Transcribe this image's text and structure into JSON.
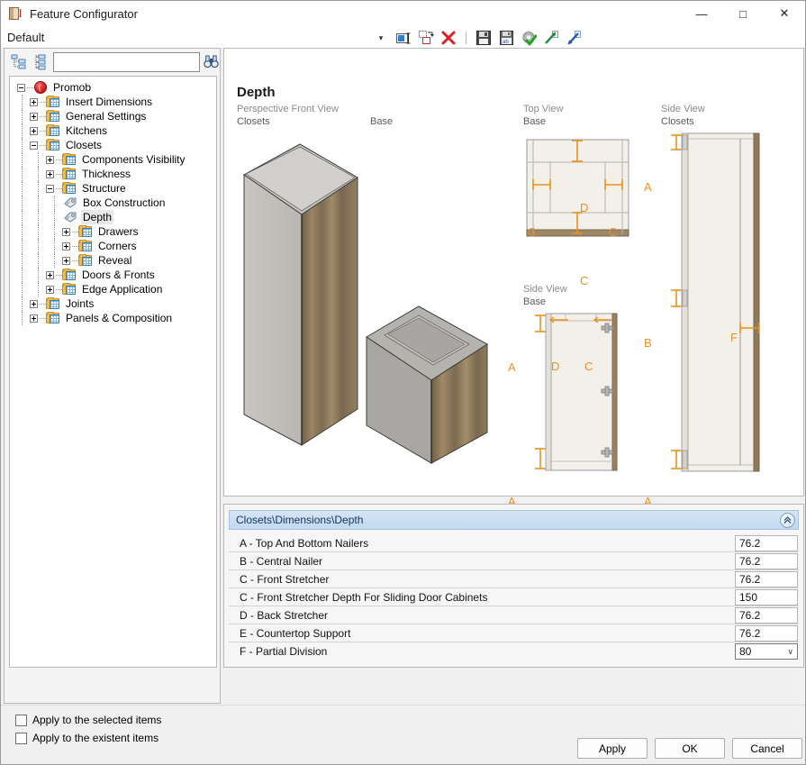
{
  "window": {
    "title": "Feature Configurator",
    "icon": "feature-configurator-icon",
    "minimize": "—",
    "maximize": "□",
    "close": "✕"
  },
  "toolbar": {
    "profile_label": "Default",
    "dropdown_arrow": "▾",
    "buttons": [
      {
        "name": "rename-button",
        "glyph": "rename-icon"
      },
      {
        "name": "duplicate-button",
        "glyph": "copy-icon"
      },
      {
        "name": "delete-button",
        "glyph": "delete-icon"
      },
      {
        "name": "save-button",
        "glyph": "save-icon"
      },
      {
        "name": "save-as-button",
        "glyph": "save-as-icon"
      },
      {
        "name": "apply-settings-button",
        "glyph": "gear-check-icon"
      },
      {
        "name": "export-button",
        "glyph": "export-arrow-icon"
      },
      {
        "name": "import-button",
        "glyph": "import-arrow-icon"
      }
    ]
  },
  "tree_panel": {
    "collapse_all_icon": "collapse-tree-icon",
    "expand_all_icon": "expand-tree-icon",
    "search": {
      "value": "",
      "placeholder": ""
    },
    "search_icon": "binoculars-icon",
    "nodes": [
      {
        "label": "Promob",
        "level": 0,
        "state": "expanded",
        "icon": "globe",
        "selected": false
      },
      {
        "label": "Insert Dimensions",
        "level": 1,
        "state": "collapsed",
        "icon": "folder",
        "selected": false
      },
      {
        "label": "General Settings",
        "level": 1,
        "state": "collapsed",
        "icon": "folder",
        "selected": false
      },
      {
        "label": "Kitchens",
        "level": 1,
        "state": "collapsed",
        "icon": "folder",
        "selected": false
      },
      {
        "label": "Closets",
        "level": 1,
        "state": "expanded",
        "icon": "folder",
        "selected": false
      },
      {
        "label": "Components Visibility",
        "level": 2,
        "state": "collapsed",
        "icon": "folder",
        "selected": false
      },
      {
        "label": "Thickness",
        "level": 2,
        "state": "collapsed",
        "icon": "folder",
        "selected": false
      },
      {
        "label": "Structure",
        "level": 2,
        "state": "expanded",
        "icon": "folder",
        "selected": false
      },
      {
        "label": "Box Construction",
        "level": 3,
        "state": "leaf",
        "icon": "tag",
        "selected": false
      },
      {
        "label": "Depth",
        "level": 3,
        "state": "leaf",
        "icon": "tag",
        "selected": true
      },
      {
        "label": "Drawers",
        "level": 3,
        "state": "collapsed",
        "icon": "folder",
        "selected": false
      },
      {
        "label": "Corners",
        "level": 3,
        "state": "collapsed",
        "icon": "folder",
        "selected": false
      },
      {
        "label": "Reveal",
        "level": 3,
        "state": "collapsed",
        "icon": "folder",
        "selected": false
      },
      {
        "label": "Doors & Fronts",
        "level": 2,
        "state": "collapsed",
        "icon": "folder",
        "selected": false
      },
      {
        "label": "Edge Application",
        "level": 2,
        "state": "collapsed",
        "icon": "folder",
        "selected": false
      },
      {
        "label": "Joints",
        "level": 1,
        "state": "collapsed",
        "icon": "folder",
        "selected": false
      },
      {
        "label": "Panels & Composition",
        "level": 1,
        "state": "collapsed",
        "icon": "folder",
        "selected": false
      }
    ]
  },
  "options": [
    {
      "label": "Apply to the selected items",
      "checked": false
    },
    {
      "label": "Apply to the existent items",
      "checked": false
    }
  ],
  "drawing": {
    "title": "Depth",
    "views": [
      {
        "kind": "Perspective Front View",
        "subject": "Closets"
      },
      {
        "kind": "",
        "subject": "Base"
      },
      {
        "kind": "Top View",
        "subject": "Base"
      },
      {
        "kind": "Side View",
        "subject": "Closets"
      },
      {
        "kind": "Side View",
        "subject": "Base"
      }
    ],
    "callout_color": "#e8921e",
    "callouts": {
      "top_view_base": [
        "D",
        "C",
        "C",
        "C"
      ],
      "side_view_base": [
        "A",
        "D",
        "C",
        "A"
      ],
      "side_view_closets": [
        "A",
        "B",
        "F",
        "A"
      ]
    }
  },
  "properties": {
    "header": "Closets\\Dimensions\\Depth",
    "collapse_glyph": "«",
    "rows": [
      {
        "name": "A - Top And Bottom Nailers",
        "value": "76.2",
        "type": "text"
      },
      {
        "name": "B - Central Nailer",
        "value": "76.2",
        "type": "text"
      },
      {
        "name": "C -  Front Stretcher",
        "value": "76.2",
        "type": "text"
      },
      {
        "name": "C - Front Stretcher Depth For Sliding Door Cabinets",
        "value": "150",
        "type": "text"
      },
      {
        "name": "D -  Back Stretcher",
        "value": "76.2",
        "type": "text"
      },
      {
        "name": "E - Countertop Support",
        "value": "76.2",
        "type": "text"
      },
      {
        "name": "F - Partial Division",
        "value": "80",
        "type": "combo",
        "arrow": "∨"
      }
    ]
  },
  "footer_buttons": [
    {
      "label": "Apply",
      "name": "apply-button"
    },
    {
      "label": "OK",
      "name": "ok-button"
    },
    {
      "label": "Cancel",
      "name": "cancel-button"
    }
  ]
}
